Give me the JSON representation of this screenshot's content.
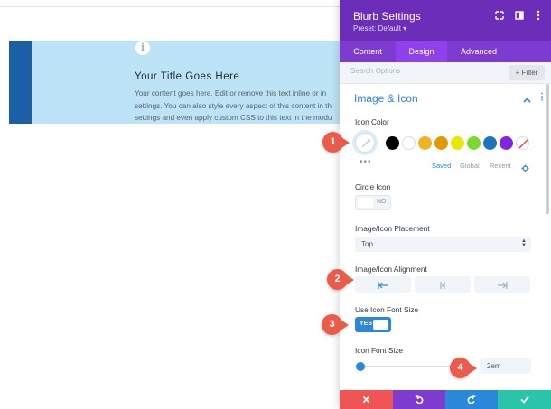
{
  "blurb": {
    "title": "Your Title Goes Here",
    "body_lines": [
      "Your content goes here. Edit or remove this text inline or in",
      "settings. You can also style every aspect of this content in th",
      "settings and even apply custom CSS to this text in the modu"
    ],
    "icon_glyph": "i"
  },
  "panel": {
    "title": "Blurb Settings",
    "preset": "Preset: Default ▾",
    "tabs": {
      "content": "Content",
      "design": "Design",
      "advanced": "Advanced"
    },
    "search_placeholder": "Search Options",
    "filter_label": "+ Filter",
    "section_title": "Image & Icon",
    "icon_color": {
      "label": "Icon Color",
      "swatches": [
        "#000000",
        "#ffffff",
        "#f0b323",
        "#e09900",
        "#e8e800",
        "#7cd933",
        "#1e73be",
        "#8224e3",
        "none"
      ],
      "links": {
        "saved": "Saved",
        "global": "Global",
        "recent": "Recent"
      },
      "more": "•••"
    },
    "circle_icon": {
      "label": "Circle Icon",
      "value": "NO"
    },
    "placement": {
      "label": "Image/Icon Placement",
      "value": "Top"
    },
    "alignment": {
      "label": "Image/Icon Alignment",
      "selected": "left"
    },
    "use_font_size": {
      "label": "Use Icon Font Size",
      "value": "YES"
    },
    "font_size": {
      "label": "Icon Font Size",
      "value": "2em"
    }
  },
  "callouts": [
    "1",
    "2",
    "3",
    "4"
  ],
  "colors": {
    "purple_header": "#6c2eb9",
    "accent_blue": "#2b87da",
    "callout_red": "#ec5b49",
    "discard": "#ef5555",
    "save": "#29c4a9"
  }
}
